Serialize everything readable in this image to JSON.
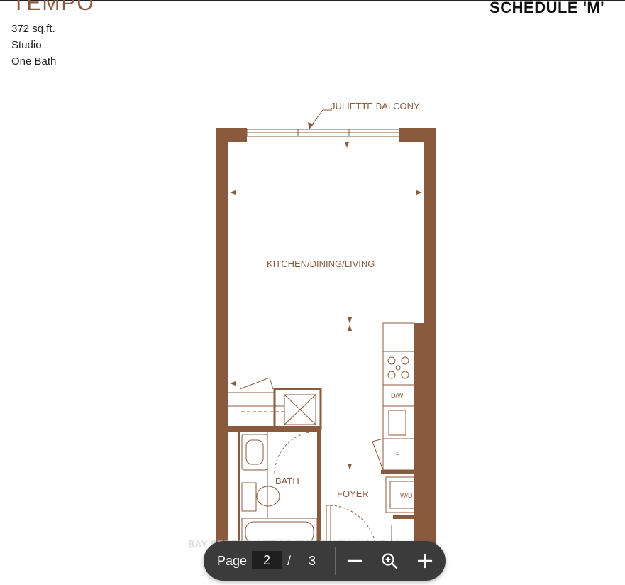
{
  "header": {
    "brand": "TEMPO",
    "schedule": "SCHEDULE 'M'",
    "specs": [
      "372 sq.ft.",
      "Studio",
      "One Bath"
    ]
  },
  "plan": {
    "labels": {
      "balcony": "JULIETTE BALCONY",
      "main_room": "KITCHEN/DINING/LIVING",
      "bath": "BATH",
      "foyer": "FOYER",
      "dishwasher": "D/W",
      "fridge": "F",
      "washer_dryer": "W/D"
    },
    "wall_color": "#8a5a3f"
  },
  "watermark": "BAY STREET INTEGRITY REALTY INC., Brokerage",
  "pdf_toolbar": {
    "page_label": "Page",
    "current_page": "2",
    "separator": "/",
    "total_pages": "3",
    "icons": [
      "zoom-out-icon",
      "zoom-icon",
      "zoom-in-icon"
    ],
    "background": "#3b3b3b"
  }
}
